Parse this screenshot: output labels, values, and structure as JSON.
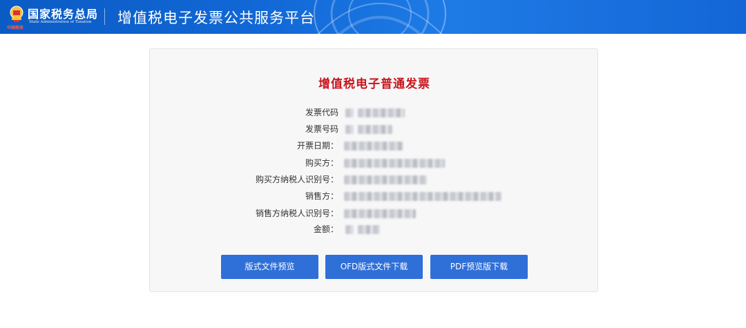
{
  "header": {
    "brand_cn": "国家税务总局",
    "brand_en": "State Administration of Taxation",
    "brand_seal": "中国税务",
    "platform_title": "增值税电子发票公共服务平台",
    "background_color": "#1168d6"
  },
  "invoice": {
    "title": "增值税电子普通发票",
    "title_color": "#c8161e",
    "fields": [
      {
        "label": "发票代码",
        "value_redacted": true
      },
      {
        "label": "发票号码",
        "value_redacted": true
      },
      {
        "label": "开票日期：",
        "value_redacted": true
      },
      {
        "label": "购买方：",
        "value_redacted": true
      },
      {
        "label": "购买方纳税人识别号：",
        "value_redacted": true
      },
      {
        "label": "销售方：",
        "value_redacted": true
      },
      {
        "label": "销售方纳税人识别号：",
        "value_redacted": true
      },
      {
        "label": "金额：",
        "value_redacted": true
      }
    ]
  },
  "actions": {
    "preview_label": "版式文件预览",
    "ofd_download_label": "OFD版式文件下载",
    "pdf_download_label": "PDF预览版下载",
    "button_color": "#2f6fd8"
  }
}
